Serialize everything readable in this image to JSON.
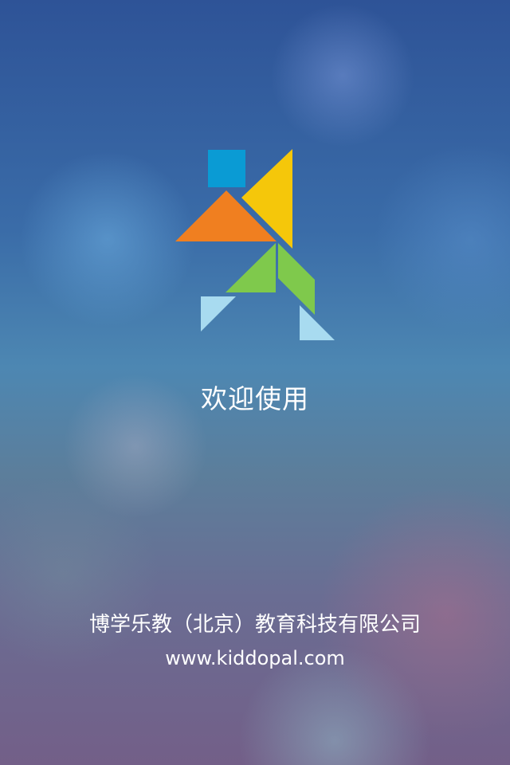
{
  "splash": {
    "logo_icon": "tangram-runner-logo-icon",
    "welcome_text": "欢迎使用",
    "company_name": "博学乐教（北京）教育科技有限公司",
    "website": "www.kiddopal.com"
  },
  "colors": {
    "logo_square": "#0a9bd4",
    "logo_yellow": "#f5c70a",
    "logo_orange": "#f07f20",
    "logo_green": "#7fc94c",
    "logo_light_blue": "#a8dbf0",
    "text": "#ffffff"
  }
}
